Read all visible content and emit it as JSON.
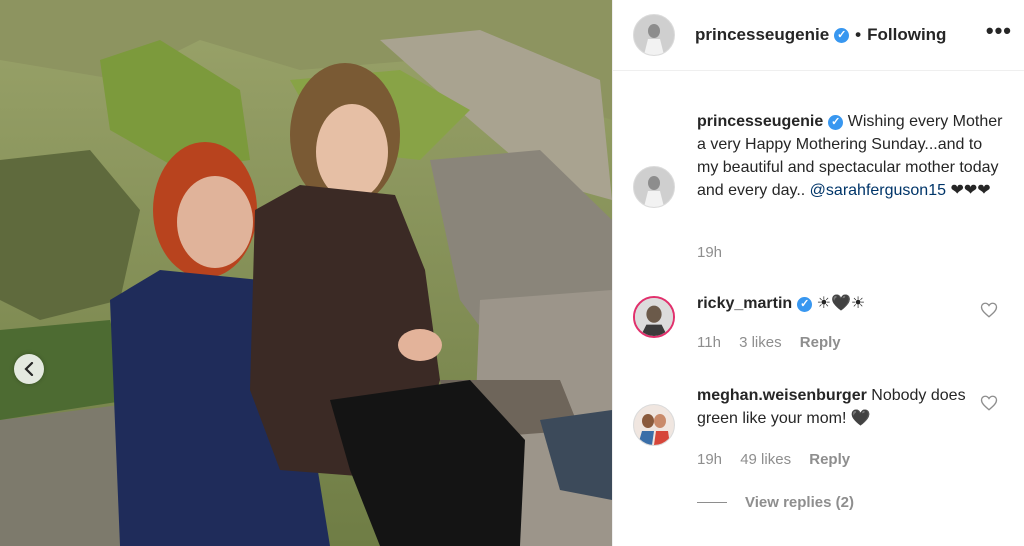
{
  "post": {
    "username": "princesseugenie",
    "verified_mark": "✓",
    "separator": "•",
    "follow_status": "Following",
    "more_icon": "•••"
  },
  "caption": {
    "username": "princesseugenie",
    "text": "Wishing every Mother a very Happy Mothering Sunday...and to my beautiful and spectacular mother today and every day..",
    "mention": "@sarahferguson15",
    "emoji": "❤❤❤",
    "time": "19h"
  },
  "comments": [
    {
      "username": "ricky_martin",
      "verified": true,
      "text": "☀🖤☀",
      "time": "11h",
      "likes": "3 likes",
      "reply": "Reply"
    },
    {
      "username": "meghan.weisenburger",
      "verified": false,
      "text": "Nobody does green like your mom! 🖤",
      "time": "19h",
      "likes": "49 likes",
      "reply": "Reply"
    }
  ],
  "view_replies": "View replies (2)",
  "colors": {
    "verified": "#3897f0",
    "muted": "#8e8e8e",
    "mention": "#003569"
  }
}
